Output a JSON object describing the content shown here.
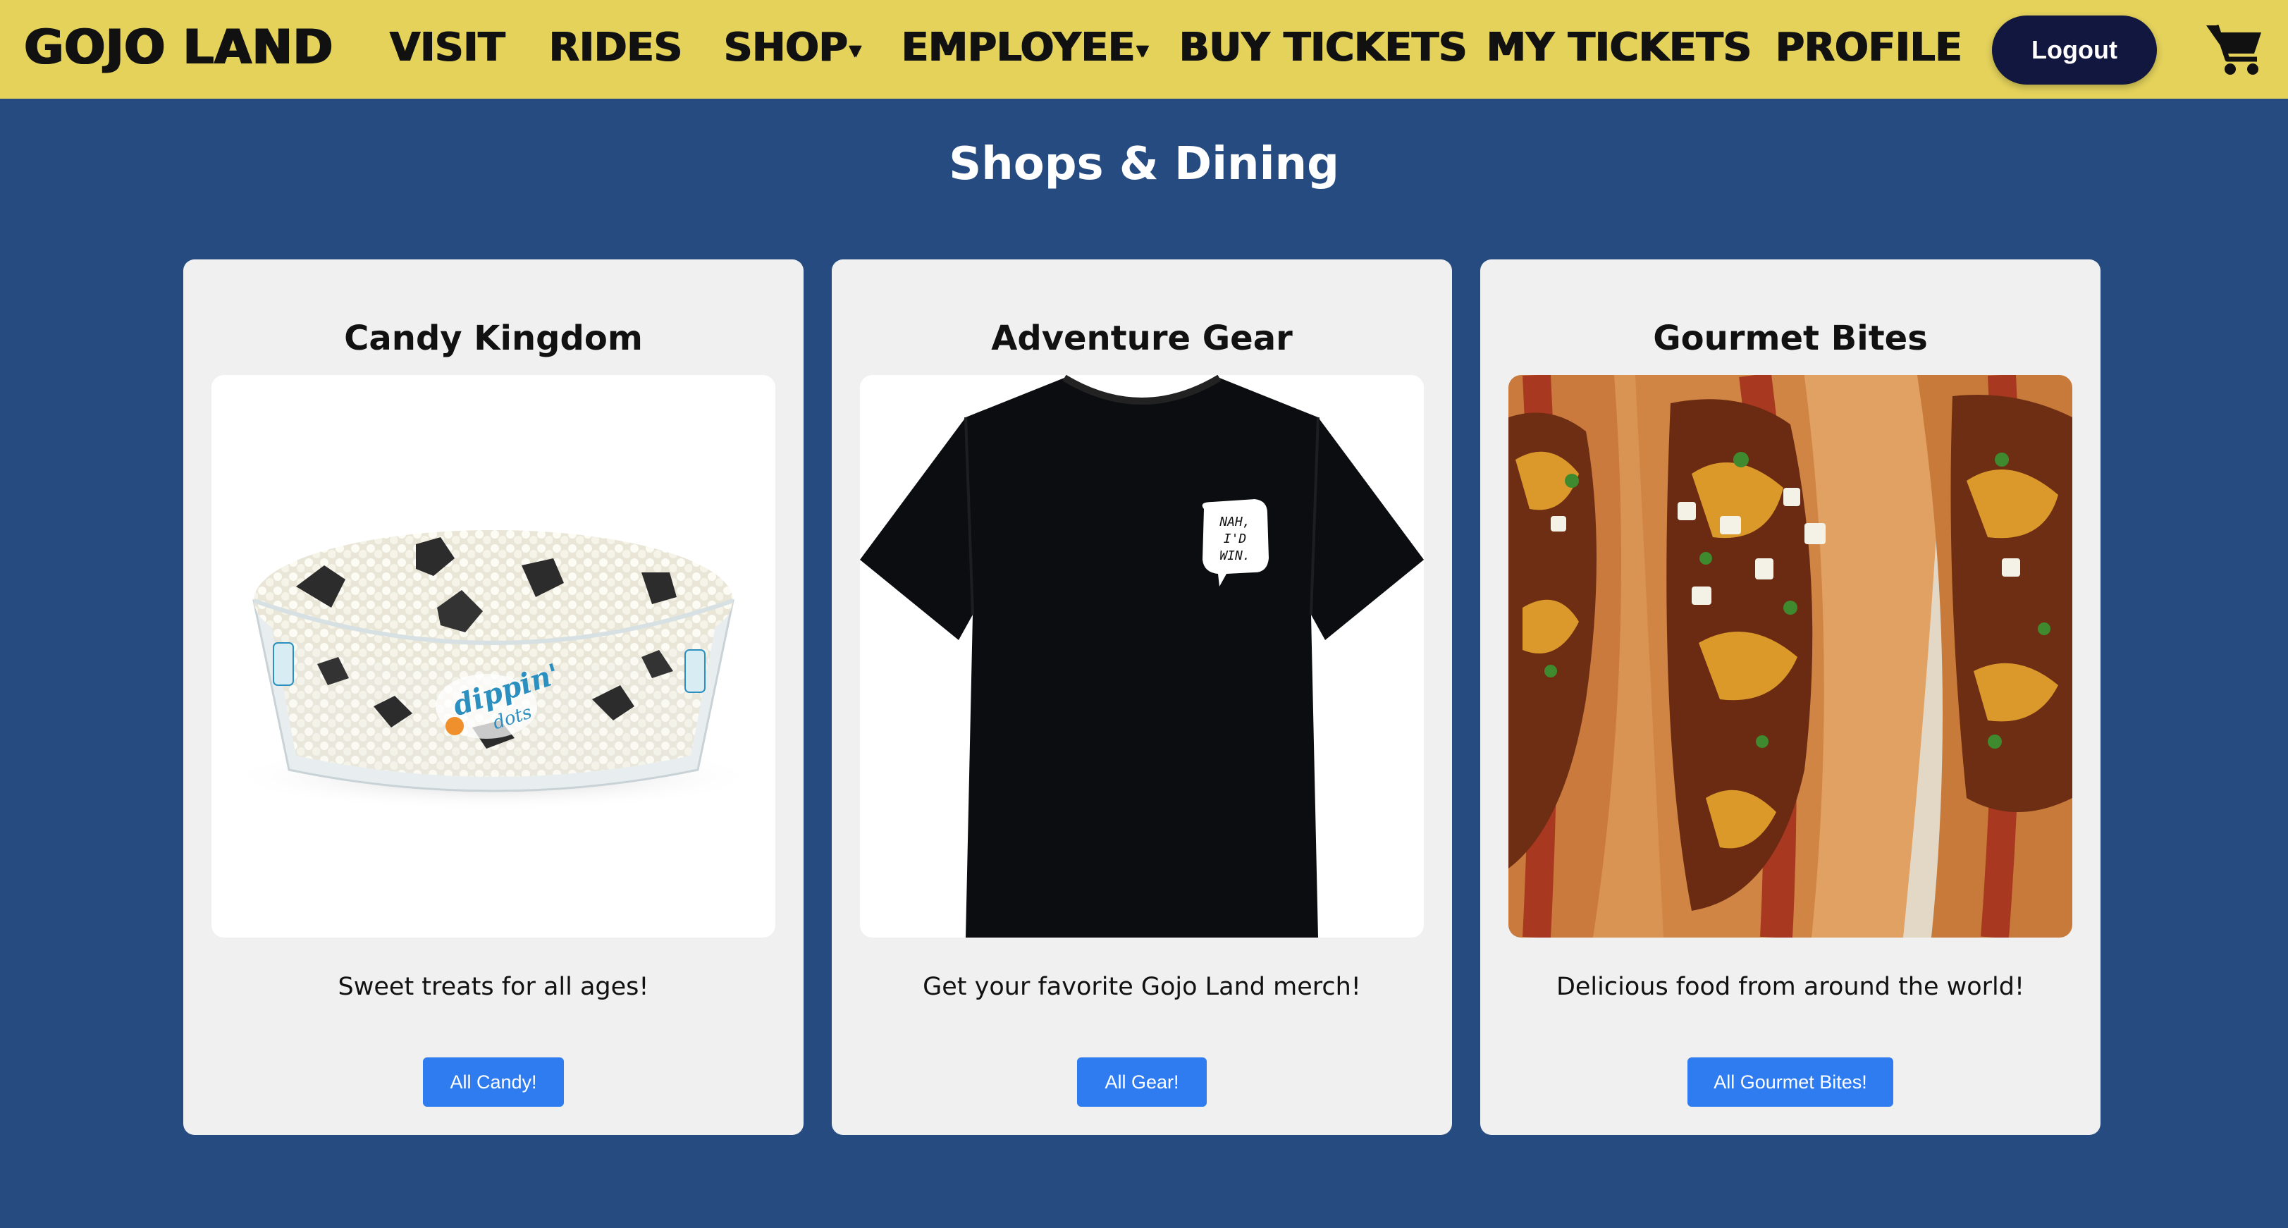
{
  "nav": {
    "brand": "GOJO LAND",
    "links": [
      {
        "label": "VISIT"
      },
      {
        "label": "RIDES"
      },
      {
        "label": "SHOP",
        "caret": "▾"
      },
      {
        "label": "EMPLOYEE",
        "caret": "▾"
      },
      {
        "label": "BUY TICKETS"
      },
      {
        "label": "MY TICKETS"
      },
      {
        "label": "PROFILE"
      }
    ],
    "logout_label": "Logout",
    "cart_icon": "shopping-cart-icon"
  },
  "page": {
    "title": "Shops & Dining"
  },
  "cards": [
    {
      "title": "Candy Kingdom",
      "image": "dippin-dots-cup-image",
      "image_text": [
        "dippin'",
        "dots"
      ],
      "description": "Sweet treats for all ages!",
      "button_label": "All Candy!"
    },
    {
      "title": "Adventure Gear",
      "image": "black-tshirt-image",
      "image_text": [
        "NAH,",
        "I'D",
        "WIN."
      ],
      "description": "Get your favorite Gojo Land merch!",
      "button_label": "All Gear!"
    },
    {
      "title": "Gourmet Bites",
      "image": "chili-cheese-hotdogs-image",
      "description": "Delicious food from around the world!",
      "button_label": "All Gourmet Bites!"
    }
  ],
  "colors": {
    "background": "#254b80",
    "navbar": "#e4d25b",
    "logout_button": "#12173f",
    "card": "#f0f0f1",
    "action_button": "#2f7cf1"
  }
}
